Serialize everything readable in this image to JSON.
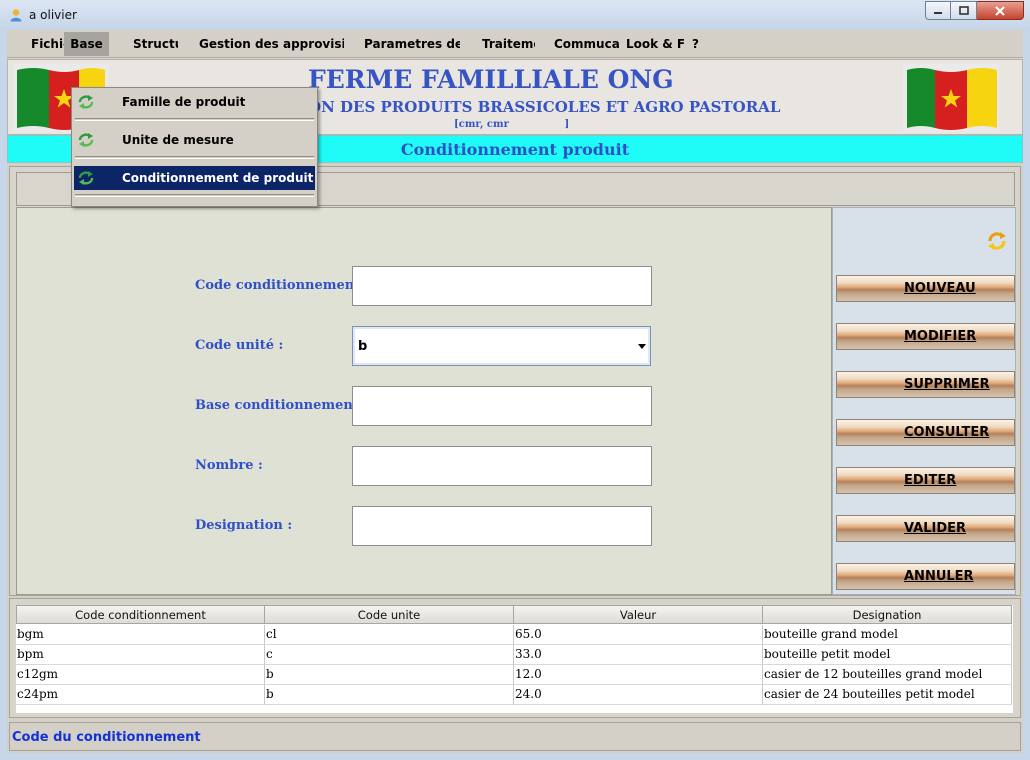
{
  "window": {
    "title": "a olivier"
  },
  "menubar": {
    "items": [
      "Fichie",
      "Base",
      "Structu",
      "Gestion des approvisionn",
      "Parametres de v",
      "Traiteme",
      "Commucati",
      "Look & Fee",
      "?"
    ]
  },
  "dropdown": {
    "items": [
      "Famille de produit",
      "Unite de mesure",
      "Conditionnement de produit"
    ],
    "selected": "Conditionnement de produit"
  },
  "header": {
    "title": "FERME FAMILLIALE ONG",
    "subtitle": "ON DES PRODUITS BRASSICOLES ET AGRO PASTORAL",
    "location": "[cmr, cmr                ]"
  },
  "page": {
    "title": "Conditionnement produit"
  },
  "form": {
    "code_conditionnement_label": "Code conditionnement :",
    "code_conditionnement_value": "",
    "code_unite_label": "Code unité :",
    "code_unite_value": "b",
    "base_conditionnement_label": "Base conditionnement :",
    "base_conditionnement_value": "",
    "nombre_label": "Nombre :",
    "nombre_value": "",
    "designation_label": "Designation :",
    "designation_value": ""
  },
  "actions": [
    "NOUVEAU",
    "MODIFIER",
    "SUPPRIMER",
    "CONSULTER",
    "EDITER",
    "VALIDER",
    "ANNULER"
  ],
  "table": {
    "columns": [
      "Code conditionnement",
      "Code unite",
      "Valeur",
      "Designation"
    ],
    "rows": [
      [
        "bgm",
        "cl",
        "65.0",
        "bouteille grand model"
      ],
      [
        "bpm",
        "c",
        "33.0",
        "bouteille petit model"
      ],
      [
        "c12gm",
        "b",
        "12.0",
        "casier de 12 bouteilles grand model"
      ],
      [
        "c24pm",
        "b",
        "24.0",
        "casier de 24 bouteilles petit model"
      ]
    ]
  },
  "status": {
    "text": "Code du conditionnement"
  },
  "colors": {
    "banner": "#1ffcf7",
    "accent_blue": "#3654c4",
    "selection": "#0b2566"
  }
}
